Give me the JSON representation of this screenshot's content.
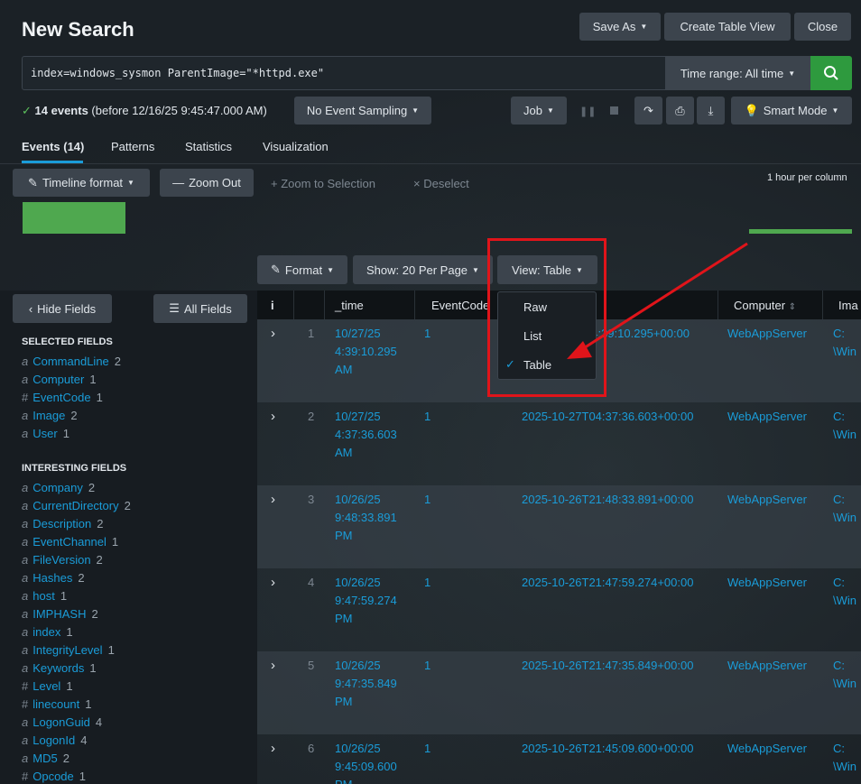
{
  "page": {
    "title": "New Search"
  },
  "header_buttons": {
    "save_as": "Save As",
    "create_table_view": "Create Table View",
    "close": "Close"
  },
  "search": {
    "query": "index=windows_sysmon ParentImage=\"*httpd.exe\"",
    "time_range": "Time range: All time"
  },
  "status": {
    "count": "14 events",
    "detail": "(before 12/16/25 9:45:47.000 AM)",
    "sampling": "No Event Sampling",
    "job": "Job",
    "mode": "Smart Mode"
  },
  "tabs": [
    "Events (14)",
    "Patterns",
    "Statistics",
    "Visualization"
  ],
  "timeline": {
    "format": "Timeline format",
    "zoom_out": "Zoom Out",
    "zoom_selection": "Zoom to Selection",
    "deselect": "Deselect",
    "scale": "1 hour per column"
  },
  "results_toolbar": {
    "format": "Format",
    "show": "Show: 20 Per Page",
    "view": "View: Table"
  },
  "view_menu": {
    "options": [
      "Raw",
      "List",
      "Table"
    ],
    "selected": "Table"
  },
  "sidebar": {
    "hide_fields": "Hide Fields",
    "all_fields": "All Fields",
    "selected_title": "SELECTED FIELDS",
    "selected": [
      {
        "type": "a",
        "name": "CommandLine",
        "count": "2"
      },
      {
        "type": "a",
        "name": "Computer",
        "count": "1"
      },
      {
        "type": "#",
        "name": "EventCode",
        "count": "1"
      },
      {
        "type": "a",
        "name": "Image",
        "count": "2"
      },
      {
        "type": "a",
        "name": "User",
        "count": "1"
      }
    ],
    "interesting_title": "INTERESTING FIELDS",
    "interesting": [
      {
        "type": "a",
        "name": "Company",
        "count": "2"
      },
      {
        "type": "a",
        "name": "CurrentDirectory",
        "count": "2"
      },
      {
        "type": "a",
        "name": "Description",
        "count": "2"
      },
      {
        "type": "a",
        "name": "EventChannel",
        "count": "1"
      },
      {
        "type": "a",
        "name": "FileVersion",
        "count": "2"
      },
      {
        "type": "a",
        "name": "Hashes",
        "count": "2"
      },
      {
        "type": "a",
        "name": "host",
        "count": "1"
      },
      {
        "type": "a",
        "name": "IMPHASH",
        "count": "2"
      },
      {
        "type": "a",
        "name": "index",
        "count": "1"
      },
      {
        "type": "a",
        "name": "IntegrityLevel",
        "count": "1"
      },
      {
        "type": "a",
        "name": "Keywords",
        "count": "1"
      },
      {
        "type": "#",
        "name": "Level",
        "count": "1"
      },
      {
        "type": "#",
        "name": "linecount",
        "count": "1"
      },
      {
        "type": "a",
        "name": "LogonGuid",
        "count": "4"
      },
      {
        "type": "a",
        "name": "LogonId",
        "count": "4"
      },
      {
        "type": "a",
        "name": "MD5",
        "count": "2"
      },
      {
        "type": "#",
        "name": "Opcode",
        "count": "1"
      }
    ]
  },
  "table": {
    "columns": [
      "i",
      "_time",
      "EventCode",
      "Computer",
      "Ima"
    ],
    "rows": [
      {
        "n": "1",
        "time": [
          "10/27/25",
          "4:39:10.295",
          "AM"
        ],
        "code": "1",
        "ts": "04:39:10.295+00:00",
        "computer": "WebAppServer",
        "image": [
          "C:",
          "\\Win"
        ]
      },
      {
        "n": "2",
        "time": [
          "10/27/25",
          "4:37:36.603",
          "AM"
        ],
        "code": "1",
        "ts": "2025-10-27T04:37:36.603+00:00",
        "computer": "WebAppServer",
        "image": [
          "C:",
          "\\Win"
        ]
      },
      {
        "n": "3",
        "time": [
          "10/26/25",
          "9:48:33.891",
          "PM"
        ],
        "code": "1",
        "ts": "2025-10-26T21:48:33.891+00:00",
        "computer": "WebAppServer",
        "image": [
          "C:",
          "\\Win"
        ]
      },
      {
        "n": "4",
        "time": [
          "10/26/25",
          "9:47:59.274",
          "PM"
        ],
        "code": "1",
        "ts": "2025-10-26T21:47:59.274+00:00",
        "computer": "WebAppServer",
        "image": [
          "C:",
          "\\Win"
        ]
      },
      {
        "n": "5",
        "time": [
          "10/26/25",
          "9:47:35.849",
          "PM"
        ],
        "code": "1",
        "ts": "2025-10-26T21:47:35.849+00:00",
        "computer": "WebAppServer",
        "image": [
          "C:",
          "\\Win"
        ]
      },
      {
        "n": "6",
        "time": [
          "10/26/25",
          "9:45:09.600",
          "PM"
        ],
        "code": "1",
        "ts": "2025-10-26T21:45:09.600+00:00",
        "computer": "WebAppServer",
        "image": [
          "C:",
          "\\Win"
        ]
      }
    ]
  },
  "colors": {
    "accent": "#1a9cd8",
    "go": "#2e9a3e",
    "annotation": "#e0141a",
    "timeline": "#4fa84f"
  }
}
